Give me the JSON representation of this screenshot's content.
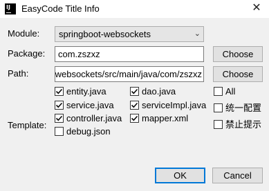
{
  "window": {
    "title": "EasyCode Title Info",
    "app_icon_text": "IJ",
    "close_glyph": "✕"
  },
  "form": {
    "module_label": "Module:",
    "module_value": "springboot-websockets",
    "package_label": "Package:",
    "package_value": "com.zszxz",
    "path_label": "Path:",
    "path_value": "…/springboot-websockets/src/main/java/com/zszxz",
    "choose_label": "Choose",
    "template_label": "Template:"
  },
  "templates": [
    {
      "label": "entity.java",
      "checked": true
    },
    {
      "label": "dao.java",
      "checked": true
    },
    {
      "label": "service.java",
      "checked": true
    },
    {
      "label": "serviceImpl.java",
      "checked": true
    },
    {
      "label": "controller.java",
      "checked": true
    },
    {
      "label": "mapper.xml",
      "checked": true
    },
    {
      "label": "debug.json",
      "checked": false
    }
  ],
  "options": {
    "all": {
      "label": "All",
      "checked": false
    },
    "unified": {
      "label": "统一配置",
      "checked": false
    },
    "no_prompt": {
      "label": "禁止提示",
      "checked": false
    }
  },
  "buttons": {
    "ok": "OK",
    "cancel": "Cancel"
  },
  "colors": {
    "accent": "#0078d7",
    "check": "#0a0a0a"
  }
}
